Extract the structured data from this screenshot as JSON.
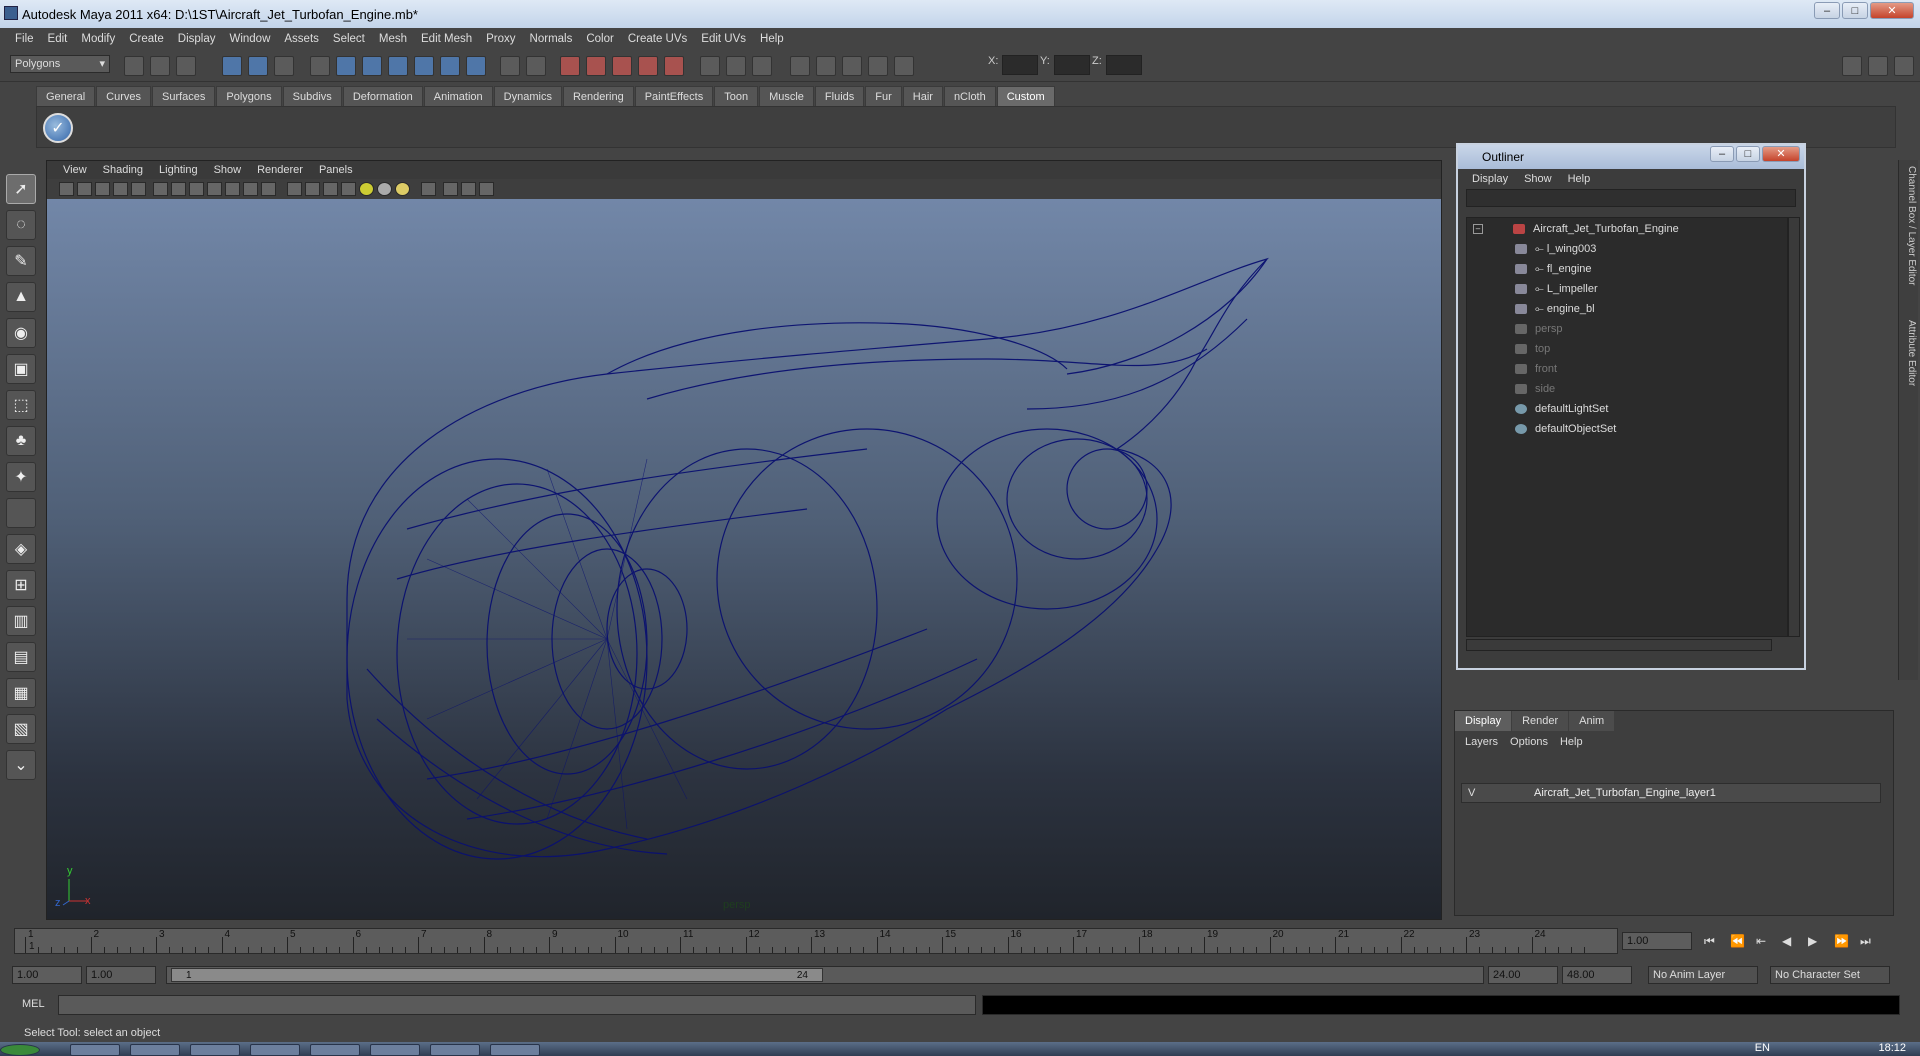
{
  "window": {
    "title": "Autodesk Maya 2011 x64: D:\\1ST\\Aircraft_Jet_Turbofan_Engine.mb*"
  },
  "menubar": [
    "File",
    "Edit",
    "Modify",
    "Create",
    "Display",
    "Window",
    "Assets",
    "Select",
    "Mesh",
    "Edit Mesh",
    "Proxy",
    "Normals",
    "Color",
    "Create UVs",
    "Edit UVs",
    "Help"
  ],
  "statusline": {
    "mode": "Polygons",
    "x_label": "X:",
    "y_label": "Y:",
    "z_label": "Z:"
  },
  "shelf": {
    "tabs": [
      "General",
      "Curves",
      "Surfaces",
      "Polygons",
      "Subdivs",
      "Deformation",
      "Animation",
      "Dynamics",
      "Rendering",
      "PaintEffects",
      "Toon",
      "Muscle",
      "Fluids",
      "Fur",
      "Hair",
      "nCloth",
      "Custom"
    ],
    "active": "Custom"
  },
  "viewport": {
    "menu": [
      "View",
      "Shading",
      "Lighting",
      "Show",
      "Renderer",
      "Panels"
    ],
    "camera": "persp",
    "axis_y": "y",
    "axis_x": "x",
    "axis_z": "z",
    "wire_color": "#0a1070"
  },
  "outliner": {
    "title": "Outliner",
    "menu": [
      "Display",
      "Show",
      "Help"
    ],
    "items": [
      {
        "label": "Aircraft_Jet_Turbofan_Engine",
        "dim": false
      },
      {
        "label": "l_wing003",
        "dim": false
      },
      {
        "label": "fl_engine",
        "dim": false
      },
      {
        "label": "L_impeller",
        "dim": false
      },
      {
        "label": "engine_bl",
        "dim": false
      },
      {
        "label": "persp",
        "dim": true
      },
      {
        "label": "top",
        "dim": true
      },
      {
        "label": "front",
        "dim": true
      },
      {
        "label": "side",
        "dim": true
      },
      {
        "label": "defaultLightSet",
        "dim": false
      },
      {
        "label": "defaultObjectSet",
        "dim": false
      }
    ]
  },
  "side_tabs": {
    "channel_box": "Channel Box / Layer Editor",
    "attribute_editor": "Attribute Editor"
  },
  "layers": {
    "tabs": [
      "Display",
      "Render",
      "Anim"
    ],
    "menu": [
      "Layers",
      "Options",
      "Help"
    ],
    "row": {
      "visible": "V",
      "name": "Aircraft_Jet_Turbofan_Engine_layer1"
    }
  },
  "timeline": {
    "ticks": [
      "1",
      "2",
      "3",
      "4",
      "5",
      "6",
      "7",
      "8",
      "9",
      "10",
      "11",
      "12",
      "13",
      "14",
      "15",
      "16",
      "17",
      "18",
      "19",
      "20",
      "21",
      "22",
      "23",
      "24"
    ],
    "current_marker": "1",
    "current_frame": "1.00"
  },
  "range": {
    "start": "1.00",
    "playback_start": "1.00",
    "slider_start": "1",
    "slider_end": "24",
    "playback_end": "24.00",
    "end": "48.00",
    "anim_layer": "No Anim Layer",
    "character_set": "No Character Set"
  },
  "mel": {
    "label": "MEL"
  },
  "helpline": "Select Tool: select an object",
  "taskbar": {
    "clock": "18:12",
    "lang": "EN"
  }
}
